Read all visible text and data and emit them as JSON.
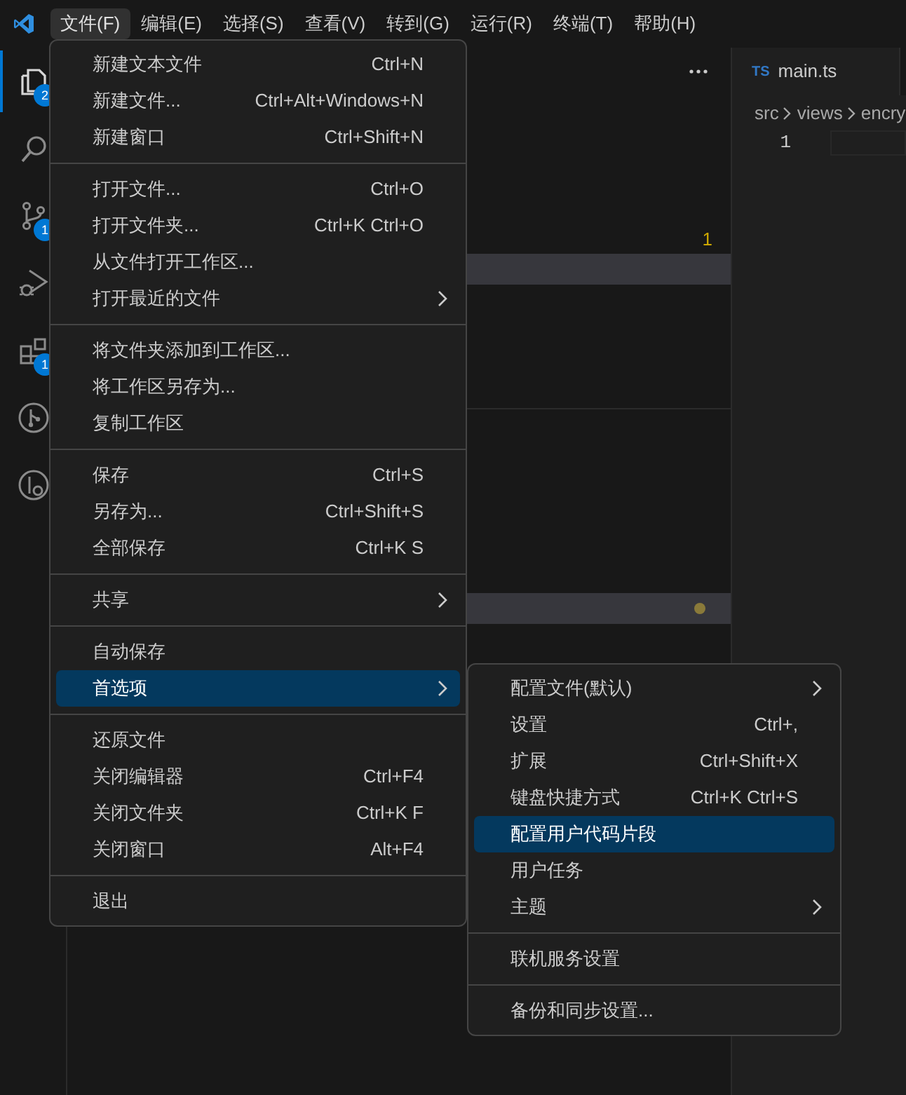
{
  "menubar": [
    {
      "label": "文件(F)",
      "selected": true
    },
    {
      "label": "编辑(E)",
      "selected": false
    },
    {
      "label": "选择(S)",
      "selected": false
    },
    {
      "label": "查看(V)",
      "selected": false
    },
    {
      "label": "转到(G)",
      "selected": false
    },
    {
      "label": "运行(R)",
      "selected": false
    },
    {
      "label": "终端(T)",
      "selected": false
    },
    {
      "label": "帮助(H)",
      "selected": false
    }
  ],
  "activity_bar": [
    {
      "kind": "explorer",
      "selected": true,
      "badge": "2"
    },
    {
      "kind": "search",
      "selected": false
    },
    {
      "kind": "source-control",
      "selected": false,
      "badge": "1"
    },
    {
      "kind": "debug",
      "selected": false
    },
    {
      "kind": "extensions",
      "selected": false,
      "badge": "1"
    },
    {
      "kind": "git-graph",
      "selected": false
    },
    {
      "kind": "remote",
      "selected": false
    }
  ],
  "sidebar": {
    "problem_count": "1"
  },
  "editor": {
    "tab": {
      "badge": "TS",
      "label": "main.ts"
    },
    "breadcrumbs": [
      "src",
      "views",
      "encry"
    ],
    "line_number": "1"
  },
  "file_menu": {
    "groups": [
      [
        {
          "label": "新建文本文件",
          "shortcut": "Ctrl+N",
          "submenu": false,
          "selected": false
        },
        {
          "label": "新建文件...",
          "shortcut": "Ctrl+Alt+Windows+N",
          "submenu": false,
          "selected": false
        },
        {
          "label": "新建窗口",
          "shortcut": "Ctrl+Shift+N",
          "submenu": false,
          "selected": false
        }
      ],
      [
        {
          "label": "打开文件...",
          "shortcut": "Ctrl+O",
          "submenu": false,
          "selected": false
        },
        {
          "label": "打开文件夹...",
          "shortcut": "Ctrl+K Ctrl+O",
          "submenu": false,
          "selected": false
        },
        {
          "label": "从文件打开工作区...",
          "submenu": false,
          "selected": false
        },
        {
          "label": "打开最近的文件",
          "submenu": true,
          "selected": false
        }
      ],
      [
        {
          "label": "将文件夹添加到工作区...",
          "submenu": false,
          "selected": false
        },
        {
          "label": "将工作区另存为...",
          "submenu": false,
          "selected": false
        },
        {
          "label": "复制工作区",
          "submenu": false,
          "selected": false
        }
      ],
      [
        {
          "label": "保存",
          "shortcut": "Ctrl+S",
          "submenu": false,
          "selected": false
        },
        {
          "label": "另存为...",
          "shortcut": "Ctrl+Shift+S",
          "submenu": false,
          "selected": false
        },
        {
          "label": "全部保存",
          "shortcut": "Ctrl+K S",
          "submenu": false,
          "selected": false
        }
      ],
      [
        {
          "label": "共享",
          "submenu": true,
          "selected": false
        }
      ],
      [
        {
          "label": "自动保存",
          "submenu": false,
          "selected": false
        },
        {
          "label": "首选项",
          "submenu": true,
          "selected": true
        }
      ],
      [
        {
          "label": "还原文件",
          "submenu": false,
          "selected": false
        },
        {
          "label": "关闭编辑器",
          "shortcut": "Ctrl+F4",
          "submenu": false,
          "selected": false
        },
        {
          "label": "关闭文件夹",
          "shortcut": "Ctrl+K F",
          "submenu": false,
          "selected": false
        },
        {
          "label": "关闭窗口",
          "shortcut": "Alt+F4",
          "submenu": false,
          "selected": false
        }
      ],
      [
        {
          "label": "退出",
          "submenu": false,
          "selected": false
        }
      ]
    ]
  },
  "preferences_submenu": {
    "groups": [
      [
        {
          "label": "配置文件(默认)",
          "submenu": true,
          "selected": false
        },
        {
          "label": "设置",
          "shortcut": "Ctrl+,",
          "submenu": false,
          "selected": false
        },
        {
          "label": "扩展",
          "shortcut": "Ctrl+Shift+X",
          "submenu": false,
          "selected": false
        },
        {
          "label": "键盘快捷方式",
          "shortcut": "Ctrl+K Ctrl+S",
          "submenu": false,
          "selected": false
        },
        {
          "label": "配置用户代码片段",
          "submenu": false,
          "selected": true
        },
        {
          "label": "用户任务",
          "submenu": false,
          "selected": false
        },
        {
          "label": "主题",
          "submenu": true,
          "selected": false
        }
      ],
      [
        {
          "label": "联机服务设置",
          "submenu": false,
          "selected": false
        }
      ],
      [
        {
          "label": "备份和同步设置...",
          "submenu": false,
          "selected": false
        }
      ]
    ]
  }
}
